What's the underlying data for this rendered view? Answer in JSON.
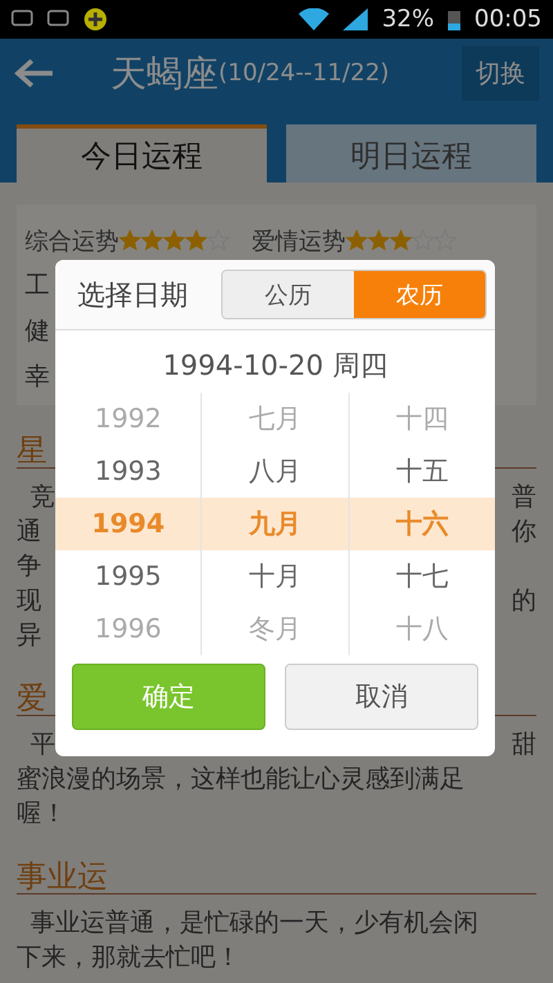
{
  "status_bar": {
    "battery": "32%",
    "time": "00:05"
  },
  "header": {
    "title": "天蝎座",
    "range": "(10/24--11/22)",
    "switch_button": "切换"
  },
  "tabs": [
    {
      "label": "今日运程",
      "selected": true
    },
    {
      "label": "明日运程",
      "selected": false
    }
  ],
  "ratings": [
    {
      "label": "综合运势",
      "stars": 4
    },
    {
      "label": "爱情运势",
      "stars": 3
    }
  ],
  "card_lines": [
    {
      "left": "工"
    },
    {
      "left": "健"
    },
    {
      "left": "幸"
    }
  ],
  "sections": [
    {
      "heading": "星",
      "lines": [
        {
          "left": "竞",
          "right": "普",
          "indent": true
        },
        {
          "left": "通",
          "right": "你",
          "indent": false
        },
        {
          "left": "争",
          "indent": false
        },
        {
          "left": "现",
          "right": "的",
          "indent": false
        },
        {
          "left": "异",
          "indent": false
        }
      ]
    },
    {
      "heading": "爱",
      "lines": [
        {
          "left": "平",
          "right": "甜",
          "indent": true
        },
        {
          "left": "蜜浪漫的场景，这样也能让心灵感到满足",
          "indent": false
        },
        {
          "left": "喔！",
          "indent": false
        }
      ]
    },
    {
      "heading": "事业运",
      "lines": [
        {
          "left": "事业运普通，是忙碌的一天，少有机会闲",
          "indent": true
        },
        {
          "left": "下来，那就去忙吧！",
          "indent": false
        }
      ]
    }
  ],
  "dialog": {
    "title": "选择日期",
    "calendar_tabs": [
      {
        "label": "公历",
        "selected": false
      },
      {
        "label": "农历",
        "selected": true
      }
    ],
    "date": "1994-10-20 周四",
    "wheels": [
      {
        "items": [
          {
            "label": "1992",
            "selected": false
          },
          {
            "label": "1993",
            "selected": false
          },
          {
            "label": "1994",
            "selected": true
          },
          {
            "label": "1995",
            "selected": false
          },
          {
            "label": "1996",
            "selected": false
          }
        ]
      },
      {
        "items": [
          {
            "label": "七月",
            "selected": false
          },
          {
            "label": "八月",
            "selected": false
          },
          {
            "label": "九月",
            "selected": true
          },
          {
            "label": "十月",
            "selected": false
          },
          {
            "label": "冬月",
            "selected": false
          }
        ]
      },
      {
        "items": [
          {
            "label": "十四",
            "selected": false
          },
          {
            "label": "十五",
            "selected": false
          },
          {
            "label": "十六",
            "selected": true
          },
          {
            "label": "十七",
            "selected": false
          },
          {
            "label": "十八",
            "selected": false
          }
        ]
      }
    ],
    "confirm_button": "确定",
    "cancel_button": "取消"
  }
}
